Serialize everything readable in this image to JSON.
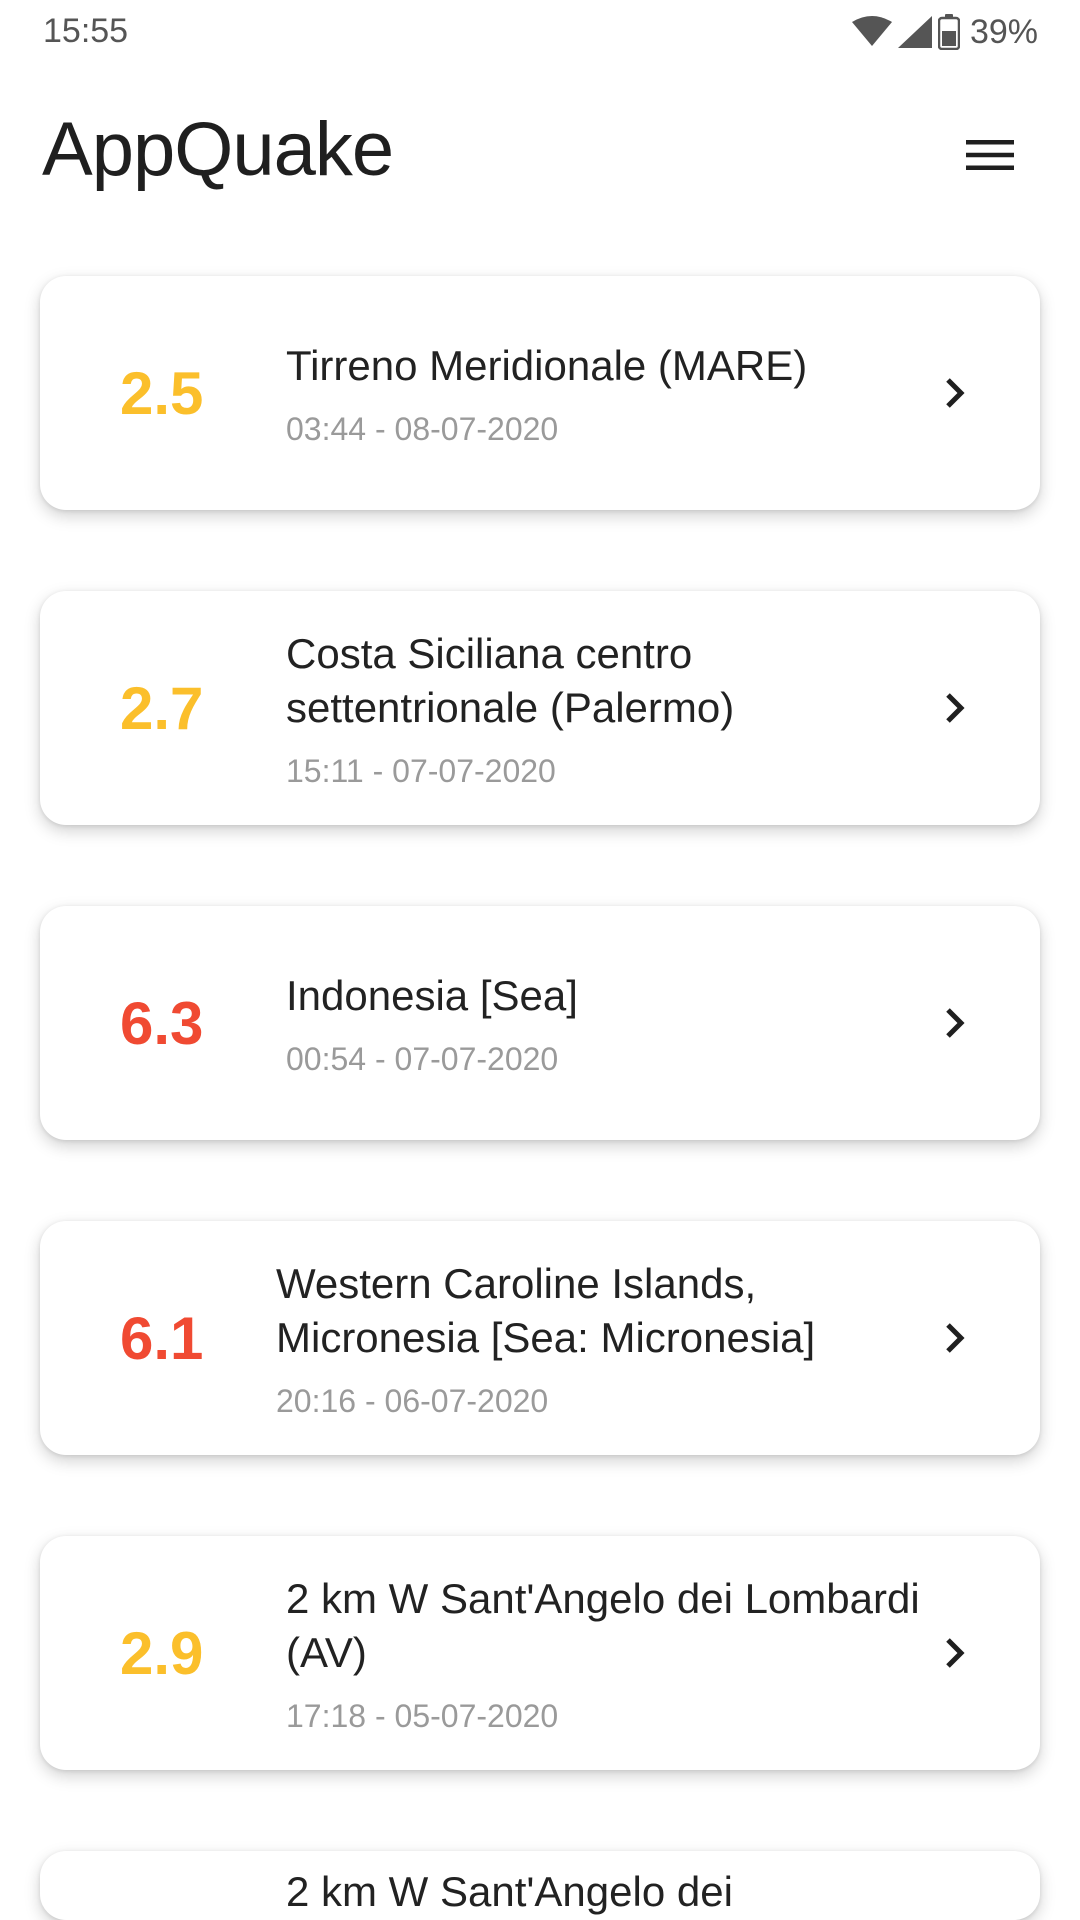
{
  "status_bar": {
    "time": "15:55",
    "battery_percent": "39%",
    "icons": [
      "wifi-icon",
      "signal-icon",
      "battery-icon"
    ]
  },
  "header": {
    "title": "AppQuake",
    "menu_icon": "hamburger-menu-icon"
  },
  "colors": {
    "low_magnitude": "#fbbf2b",
    "high_magnitude": "#f04a32"
  },
  "quakes": [
    {
      "magnitude": "2.5",
      "level": "low",
      "place": "Tirreno Meridionale (MARE)",
      "time": "03:44 - 08-07-2020"
    },
    {
      "magnitude": "2.7",
      "level": "low",
      "place": "Costa Siciliana centro settentrionale (Palermo)",
      "time": "15:11 - 07-07-2020"
    },
    {
      "magnitude": "6.3",
      "level": "high",
      "place": "Indonesia [Sea]",
      "time": "00:54 - 07-07-2020"
    },
    {
      "magnitude": "6.1",
      "level": "high",
      "place": "Western Caroline Islands, Micronesia [Sea: Micronesia]",
      "time": "20:16 - 06-07-2020"
    },
    {
      "magnitude": "2.9",
      "level": "low",
      "place": "2 km W Sant'Angelo dei Lombardi (AV)",
      "time": "17:18 - 05-07-2020"
    },
    {
      "magnitude": "",
      "level": "low",
      "place": "2 km W Sant'Angelo dei",
      "time": ""
    }
  ]
}
